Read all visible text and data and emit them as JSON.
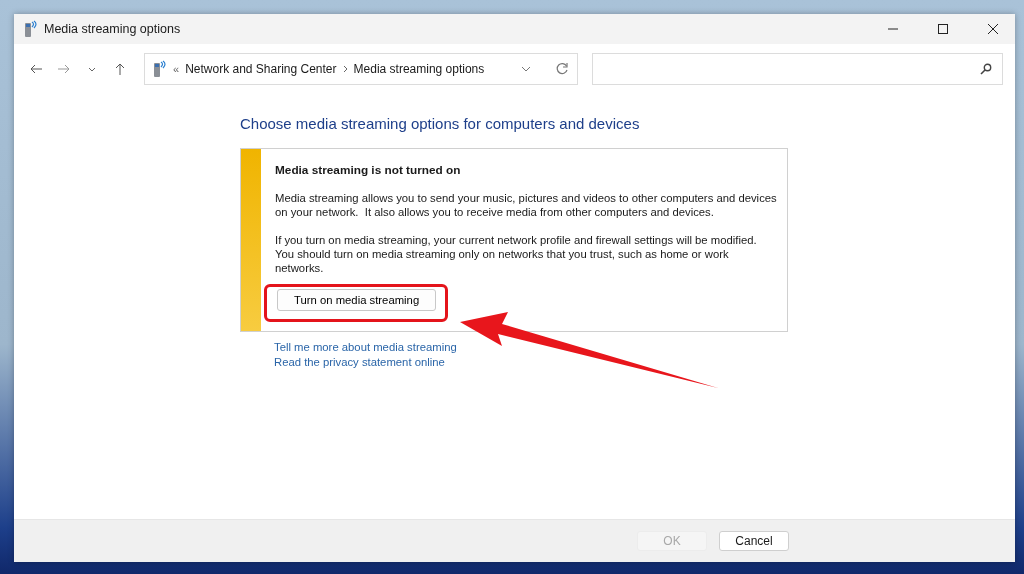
{
  "window": {
    "title": "Media streaming options"
  },
  "address_bar": {
    "overflow": "«",
    "breadcrumbs": [
      "Network and Sharing Center",
      "Media streaming options"
    ]
  },
  "page": {
    "heading": "Choose media streaming options for computers and devices",
    "notice": {
      "title": "Media streaming is not turned on",
      "paragraphs": [
        "Media streaming allows you to send your music, pictures and videos to other computers and devices on your network.  It also allows you to receive media from other computers and devices.",
        "If you turn on media streaming, your current network profile and firewall settings will be modified. You should turn on media streaming only on networks that you trust, such as home or work networks."
      ],
      "button": "Turn on media streaming"
    },
    "links": [
      "Tell me more about media streaming",
      "Read the privacy statement online"
    ]
  },
  "footer": {
    "buttons": [
      {
        "label": "OK",
        "disabled": true
      },
      {
        "label": "Cancel",
        "disabled": false
      }
    ]
  }
}
